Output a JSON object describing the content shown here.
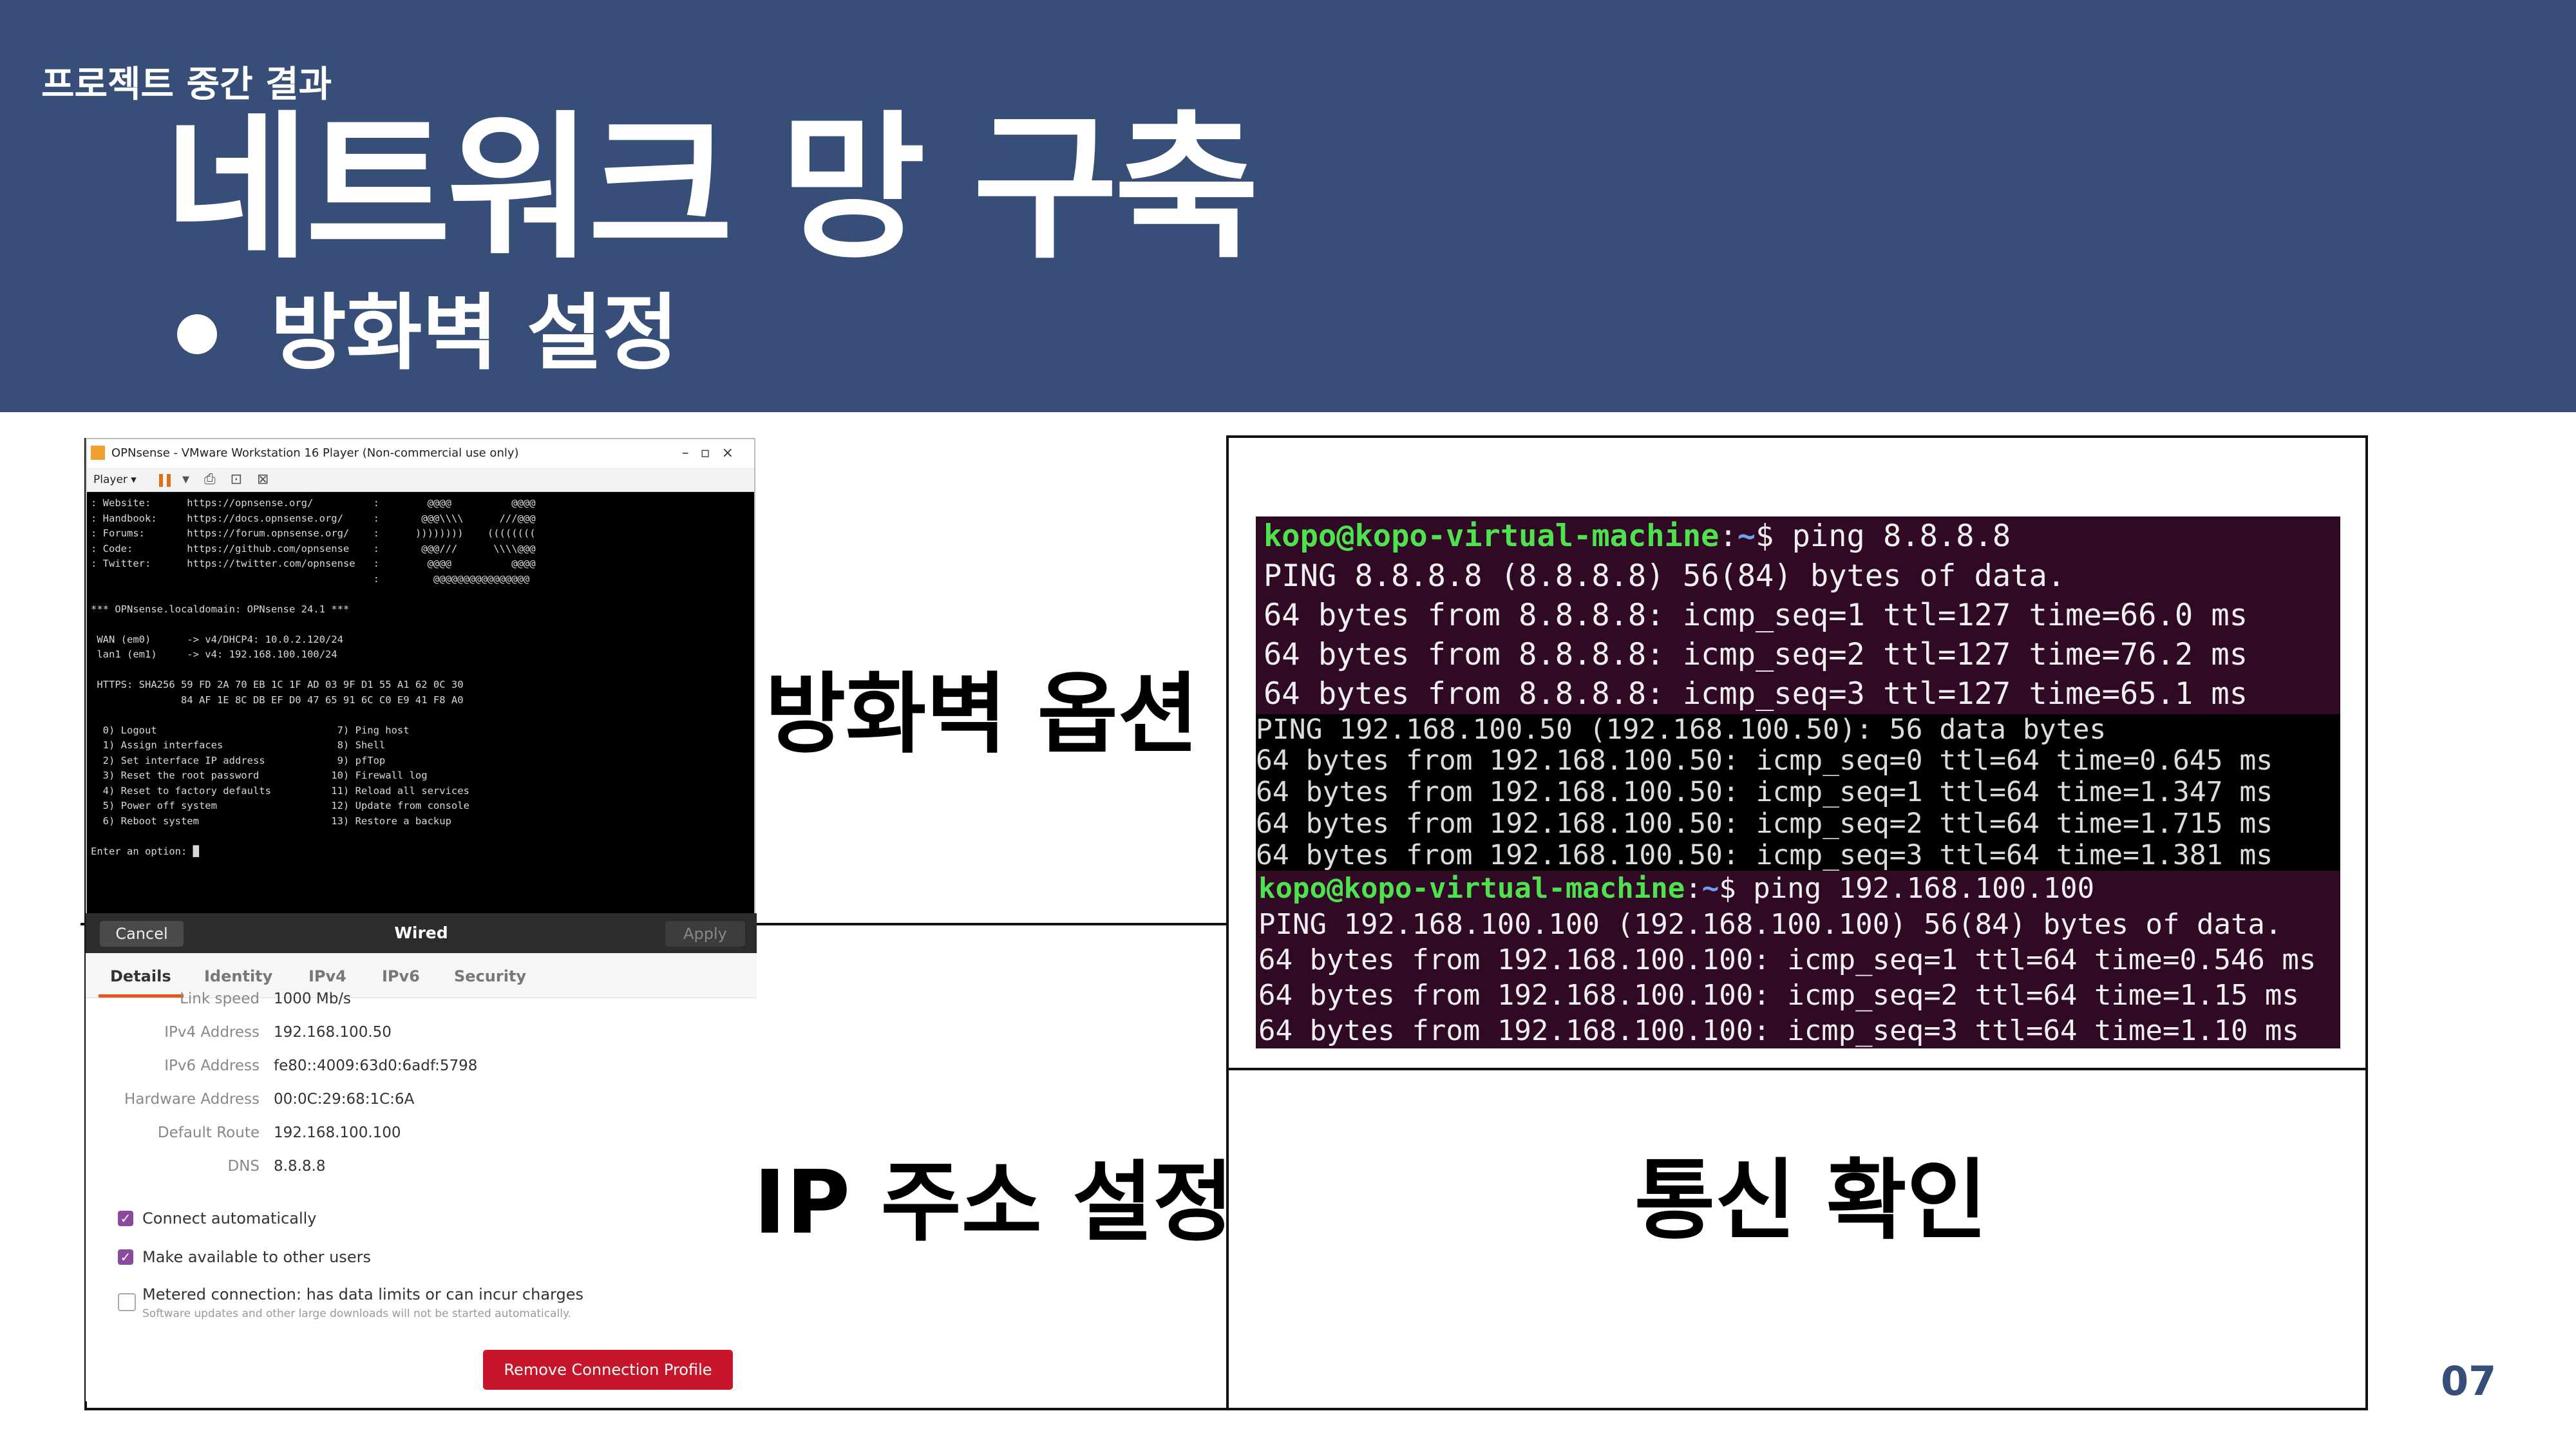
{
  "header": {
    "subtitle": "프로젝트 중간 결과",
    "title": "네트워크 망 구축",
    "bullet": "방화벽 설정"
  },
  "page_number": "07",
  "captions": {
    "firewall": "방화벽 옵션",
    "ip": "IP 주소 설정",
    "comm": "통신 확인"
  },
  "opnsense": {
    "window_title": "OPNsense - VMware Workstation 16 Player (Non-commercial use only)",
    "toolbar_player": "Player ▾",
    "console": [
      ": Website:      https://opnsense.org/          :        @@@@          @@@@",
      ": Handbook:     https://docs.opnsense.org/     :       @@@\\\\\\\\      ///@@@",
      ": Forums:       https://forum.opnsense.org/    :      ))))))))    ((((((((",
      ": Code:         https://github.com/opnsense    :       @@@///      \\\\\\\\@@@",
      ": Twitter:      https://twitter.com/opnsense   :        @@@@          @@@@",
      "                                               :         @@@@@@@@@@@@@@@@",
      "",
      "*** OPNsense.localdomain: OPNsense 24.1 ***",
      "",
      " WAN (em0)      -> v4/DHCP4: 10.0.2.120/24",
      " lan1 (em1)     -> v4: 192.168.100.100/24",
      "",
      " HTTPS: SHA256 59 FD 2A 70 EB 1C 1F AD 03 9F D1 55 A1 62 0C 30",
      "               84 AF 1E 8C DB EF D0 47 65 91 6C C0 E9 41 F8 A0",
      "",
      "  0) Logout                              7) Ping host",
      "  1) Assign interfaces                   8) Shell",
      "  2) Set interface IP address            9) pfTop",
      "  3) Reset the root password            10) Firewall log",
      "  4) Reset to factory defaults          11) Reload all services",
      "  5) Power off system                   12) Update from console",
      "  6) Reboot system                      13) Restore a backup",
      "",
      "Enter an option: █"
    ]
  },
  "settings": {
    "cancel": "Cancel",
    "title": "Wired",
    "apply": "Apply",
    "tabs": [
      "Details",
      "Identity",
      "IPv4",
      "IPv6",
      "Security"
    ],
    "rows": [
      {
        "label": "Link speed",
        "value": "1000 Mb/s"
      },
      {
        "label": "IPv4 Address",
        "value": "192.168.100.50"
      },
      {
        "label": "IPv6 Address",
        "value": "fe80::4009:63d0:6adf:5798"
      },
      {
        "label": "Hardware Address",
        "value": "00:0C:29:68:1C:6A"
      },
      {
        "label": "Default Route",
        "value": "192.168.100.100"
      },
      {
        "label": "DNS",
        "value": "8.8.8.8"
      }
    ],
    "connect_auto": "Connect automatically",
    "available_others": "Make available to other users",
    "metered": "Metered connection: has data limits or can incur charges",
    "metered_sub": "Software updates and other large downloads will not be started automatically.",
    "remove": "Remove Connection Profile"
  },
  "terminal": {
    "prompt_user": "kopo@kopo-virtual-machine",
    "prompt_sep": ":",
    "prompt_path": "~",
    "prompt_dollar": "$ ",
    "cmd1": "ping 8.8.8.8",
    "lines1": [
      "PING 8.8.8.8 (8.8.8.8) 56(84) bytes of data.",
      "64 bytes from 8.8.8.8: icmp_seq=1 ttl=127 time=66.0 ms",
      "64 bytes from 8.8.8.8: icmp_seq=2 ttl=127 time=76.2 ms",
      "64 bytes from 8.8.8.8: icmp_seq=3 ttl=127 time=65.1 ms"
    ],
    "lines2": [
      "PING 192.168.100.50 (192.168.100.50): 56 data bytes",
      "64 bytes from 192.168.100.50: icmp_seq=0 ttl=64 time=0.645 ms",
      "64 bytes from 192.168.100.50: icmp_seq=1 ttl=64 time=1.347 ms",
      "64 bytes from 192.168.100.50: icmp_seq=2 ttl=64 time=1.715 ms",
      "64 bytes from 192.168.100.50: icmp_seq=3 ttl=64 time=1.381 ms"
    ],
    "cmd2": "ping 192.168.100.100",
    "lines3": [
      "PING 192.168.100.100 (192.168.100.100) 56(84) bytes of data.",
      "64 bytes from 192.168.100.100: icmp_seq=1 ttl=64 time=0.546 ms",
      "64 bytes from 192.168.100.100: icmp_seq=2 ttl=64 time=1.15 ms",
      "64 bytes from 192.168.100.100: icmp_seq=3 ttl=64 time=1.10 ms"
    ]
  }
}
